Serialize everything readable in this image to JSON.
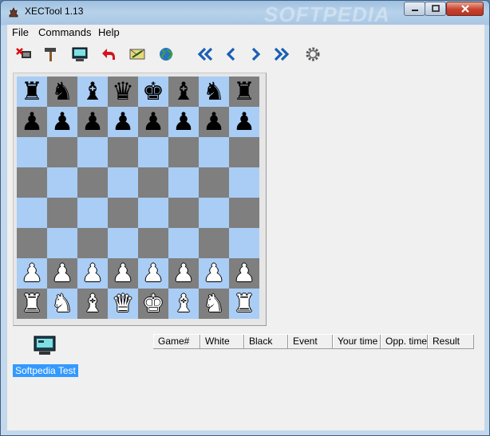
{
  "window": {
    "title": "XECTool 1.13",
    "watermark": "SOFTPEDIA"
  },
  "menu": [
    "File",
    "Commands",
    "Help"
  ],
  "toolbar": [
    {
      "icon": "disconnect-icon"
    },
    {
      "icon": "hammer-icon"
    },
    {
      "icon": "computer-icon"
    },
    {
      "icon": "undo-arrow-icon"
    },
    {
      "icon": "mail-icon"
    },
    {
      "icon": "globe-icon"
    },
    {
      "icon": "first-move-icon"
    },
    {
      "icon": "previous-move-icon"
    },
    {
      "icon": "next-move-icon"
    },
    {
      "icon": "last-move-icon"
    },
    {
      "icon": "settings-gear-icon"
    }
  ],
  "board": {
    "light_color": "#a9cdf5",
    "dark_color": "#7f7f7f",
    "rows": [
      [
        "♜",
        "♞",
        "♝",
        "♛",
        "♚",
        "♝",
        "♞",
        "♜"
      ],
      [
        "♟",
        "♟",
        "♟",
        "♟",
        "♟",
        "♟",
        "♟",
        "♟"
      ],
      [
        "",
        "",
        "",
        "",
        "",
        "",
        "",
        ""
      ],
      [
        "",
        "",
        "",
        "",
        "",
        "",
        "",
        ""
      ],
      [
        "",
        "",
        "",
        "",
        "",
        "",
        "",
        ""
      ],
      [
        "",
        "",
        "",
        "",
        "",
        "",
        "",
        ""
      ],
      [
        "♟",
        "♟",
        "♟",
        "♟",
        "♟",
        "♟",
        "♟",
        "♟"
      ],
      [
        "♜",
        "♞",
        "♝",
        "♛",
        "♚",
        "♝",
        "♞",
        "♜"
      ]
    ],
    "piece_colors": [
      "black",
      "black",
      "",
      "",
      "",
      "",
      "white",
      "white"
    ]
  },
  "player": {
    "name": "Softpedia Test"
  },
  "games_table": {
    "columns": [
      "Game#",
      "White",
      "Black",
      "Event",
      "Your time",
      "Opp. time",
      "Result"
    ]
  }
}
